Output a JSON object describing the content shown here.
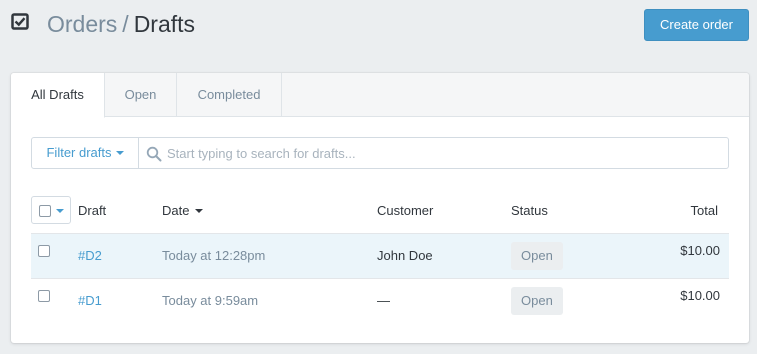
{
  "header": {
    "icon": "checkbox-check-icon",
    "breadcrumb_parent": "Orders",
    "breadcrumb_separator": "/",
    "breadcrumb_current": "Drafts",
    "create_label": "Create order"
  },
  "tabs": [
    {
      "label": "All Drafts",
      "active": true
    },
    {
      "label": "Open",
      "active": false
    },
    {
      "label": "Completed",
      "active": false
    }
  ],
  "filter": {
    "button_label": "Filter drafts",
    "search_placeholder": "Start typing to search for drafts..."
  },
  "table": {
    "columns": {
      "draft": "Draft",
      "date": "Date",
      "customer": "Customer",
      "status": "Status",
      "total": "Total"
    },
    "rows": [
      {
        "draft": "#D2",
        "date": "Today at 12:28pm",
        "customer": "John Doe",
        "status": "Open",
        "total": "$10.00"
      },
      {
        "draft": "#D1",
        "date": "Today at 9:59am",
        "customer": "—",
        "status": "Open",
        "total": "$10.00"
      }
    ]
  },
  "colors": {
    "accent": "#479ccf",
    "background": "#ebeef0",
    "row_highlight": "#ebf5fa"
  }
}
